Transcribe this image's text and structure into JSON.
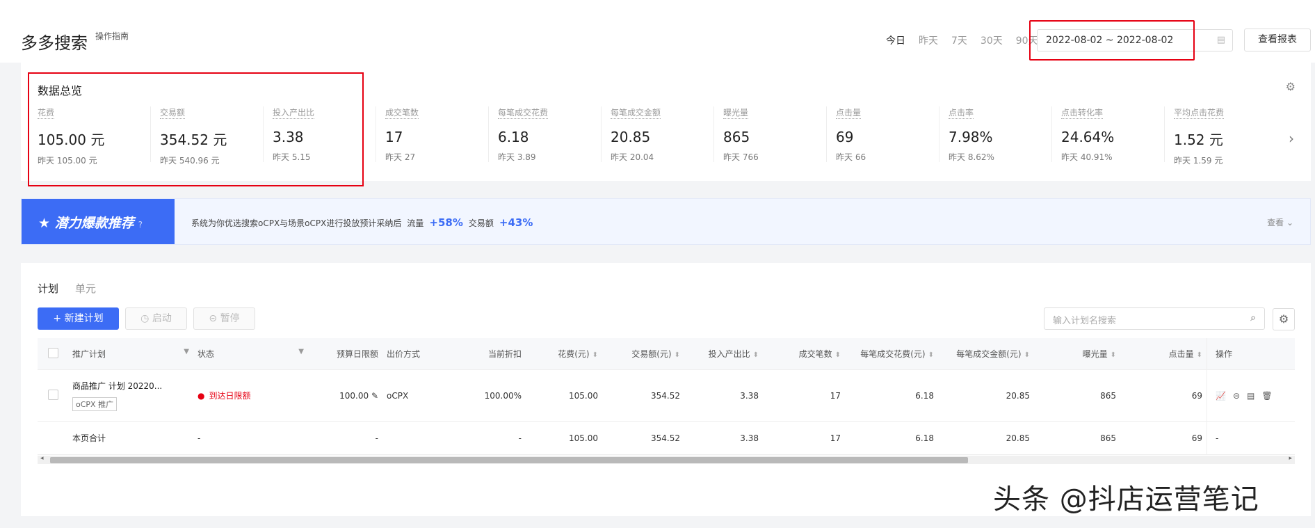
{
  "header": {
    "title": "多多搜索",
    "guide": "操作指南",
    "quick_dates": [
      "今日",
      "昨天",
      "7天",
      "30天",
      "90天"
    ],
    "date_range": "2022-08-02 ~ 2022-08-02",
    "report_button": "查看报表"
  },
  "overview": {
    "title": "数据总览",
    "yesterday_prefix": "昨天",
    "metrics": [
      {
        "label": "花费",
        "value": "105.00 元",
        "yesterday": "昨天 105.00 元"
      },
      {
        "label": "交易额",
        "value": "354.52 元",
        "yesterday": "昨天 540.96 元"
      },
      {
        "label": "投入产出比",
        "value": "3.38",
        "yesterday": "昨天 5.15"
      },
      {
        "label": "成交笔数",
        "value": "17",
        "yesterday": "昨天 27"
      },
      {
        "label": "每笔成交花费",
        "value": "6.18",
        "yesterday": "昨天 3.89"
      },
      {
        "label": "每笔成交金额",
        "value": "20.85",
        "yesterday": "昨天 20.04"
      },
      {
        "label": "曝光量",
        "value": "865",
        "yesterday": "昨天 766"
      },
      {
        "label": "点击量",
        "value": "69",
        "yesterday": "昨天 66"
      },
      {
        "label": "点击率",
        "value": "7.98%",
        "yesterday": "昨天 8.62%"
      },
      {
        "label": "点击转化率",
        "value": "24.64%",
        "yesterday": "昨天 40.91%"
      },
      {
        "label": "平均点击花费",
        "value": "1.52 元",
        "yesterday": "昨天 1.59 元"
      }
    ]
  },
  "banner": {
    "title": "★ 潜力爆款推荐",
    "text": "系统为你优选搜索oCPX与场景oCPX进行投放预计采纳后",
    "traffic_label": "流量",
    "traffic_pct": "+58%",
    "gmv_label": "交易额",
    "gmv_pct": "+43%",
    "view": "查看 ⌄"
  },
  "plans": {
    "tabs": [
      "计划",
      "单元"
    ],
    "new_button": "+ 新建计划",
    "start_button": "◷ 启动",
    "pause_button": "⊝ 暂停",
    "search_placeholder": "输入计划名搜索",
    "columns": {
      "plan": "推广计划",
      "status": "状态",
      "budget": "预算日限额",
      "bid": "出价方式",
      "discount": "当前折扣",
      "spend": "花费(元)",
      "gmv": "交易额(元)",
      "roi": "投入产出比",
      "orders": "成交笔数",
      "cpo": "每笔成交花费(元)",
      "aov": "每笔成交金额(元)",
      "impressions": "曝光量",
      "clicks": "点击量",
      "ops": "操作"
    },
    "row": {
      "name": "商品推广 计划 20220...",
      "tag": "oCPX 推广",
      "status": "到达日限额",
      "budget": "100.00",
      "bid": "oCPX",
      "discount": "100.00%",
      "spend": "105.00",
      "gmv": "354.52",
      "roi": "3.38",
      "orders": "17",
      "cpo": "6.18",
      "aov": "20.85",
      "impressions": "865",
      "clicks": "69"
    },
    "total": {
      "label": "本页合计",
      "status": "-",
      "budget": "-",
      "discount": "-",
      "spend": "105.00",
      "gmv": "354.52",
      "roi": "3.38",
      "orders": "17",
      "cpo": "6.18",
      "aov": "20.85",
      "impressions": "865",
      "clicks": "69",
      "ops": "-"
    }
  },
  "watermark": "头条 @抖店运营笔记",
  "colors": {
    "accent": "#3c6cf5",
    "highlight_box": "#e60012",
    "status_red": "#e60012"
  }
}
